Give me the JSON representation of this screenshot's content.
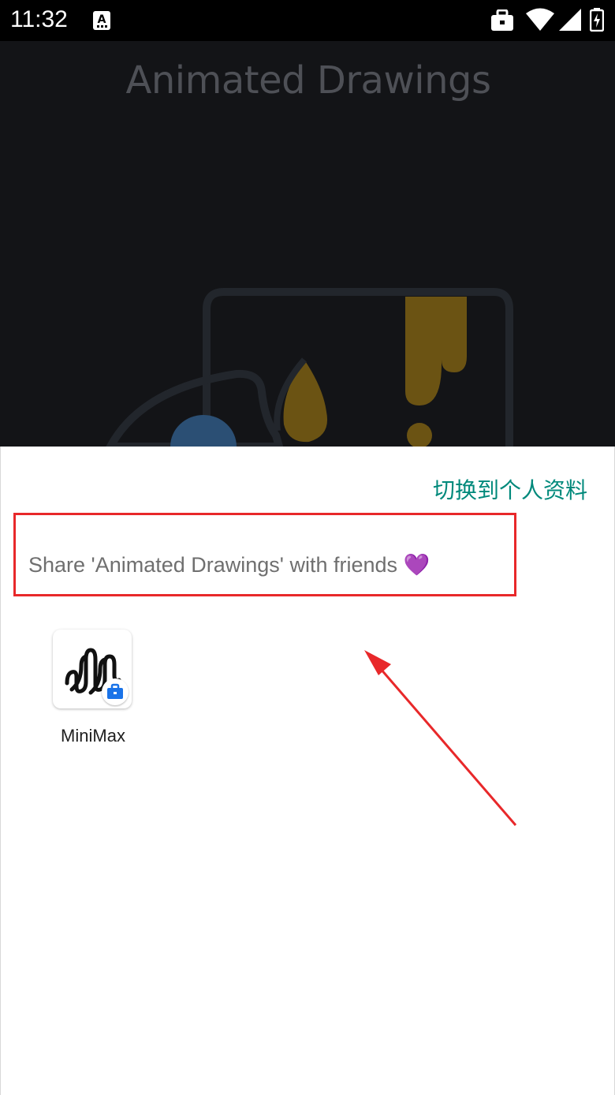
{
  "status_bar": {
    "time": "11:32",
    "icons": [
      "a-icon",
      "work-icon",
      "wifi-icon",
      "signal-icon",
      "battery-icon"
    ]
  },
  "background_app": {
    "title": "Animated Drawings"
  },
  "share_sheet": {
    "switch_profile_label": "切换到个人资料",
    "title": "Share 'Animated Drawings' with friends",
    "title_emoji": "💜",
    "targets": [
      {
        "label": "MiniMax",
        "icon": "minimax-logo-icon",
        "badge": "work-briefcase-icon"
      }
    ]
  },
  "annotation": {
    "highlight_color": "#e8282a",
    "arrow_color": "#e8282a"
  }
}
